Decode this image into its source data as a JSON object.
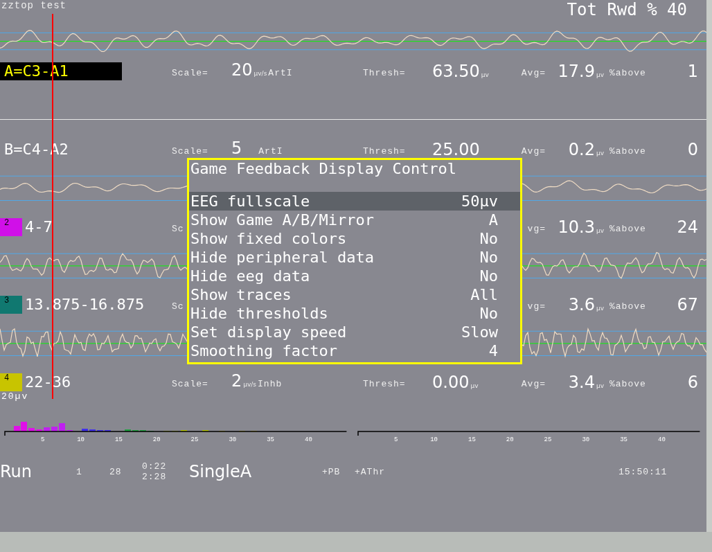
{
  "title": "zztop test",
  "reward": {
    "label": "Tot Rwd %",
    "value": "40"
  },
  "channels": [
    {
      "kind": "raw",
      "name": "A=C3-A1",
      "selected": true,
      "scale_label": "Scale=",
      "scale": "20",
      "scale_unit": "µv/s",
      "mode": "ArtI",
      "thresh_label": "Thresh=",
      "thresh": "63.50",
      "thresh_unit": "µv",
      "avg_label": "Avg=",
      "avg": "17.9",
      "avg_unit": "µv",
      "above_label": "%above",
      "above": "1"
    },
    {
      "kind": "raw",
      "name": "B=C4-A2",
      "selected": false,
      "scale_label": "Scale=",
      "scale": "5",
      "mode": "ArtI",
      "thresh_label": "Thresh=",
      "thresh": "25.00",
      "avg_label": "Avg=",
      "avg": "0.2",
      "avg_unit": "µv",
      "above_label": "%above",
      "above": "0"
    },
    {
      "kind": "band",
      "index": "2",
      "color": "#d010e8",
      "name": "4-7",
      "selected": false,
      "scale_label": "Sc",
      "avg_label": "vg=",
      "avg": "10.3",
      "avg_unit": "µv",
      "above_label": "%above",
      "above": "24"
    },
    {
      "kind": "band",
      "index": "3",
      "color": "#107870",
      "name": "13.875-16.875",
      "selected": false,
      "scale_label": "Sc",
      "avg_label": "vg=",
      "avg": "3.6",
      "avg_unit": "µv",
      "above_label": "%above",
      "above": "67"
    },
    {
      "kind": "band",
      "index": "4",
      "color": "#c8c400",
      "name": "22-36",
      "selected": false,
      "scale_label": "Scale=",
      "scale": "2",
      "scale_unit": "µv/s",
      "mode": "Inhb",
      "thresh_label": "Thresh=",
      "thresh": "0.00",
      "thresh_unit": "µv",
      "avg_label": "Avg=",
      "avg": "3.4",
      "avg_unit": "µv",
      "above_label": "%above",
      "above": "6"
    }
  ],
  "scale_note": "20µv",
  "spectra": [
    {
      "ticks": [
        "5",
        "10",
        "15",
        "20",
        "25",
        "30",
        "35",
        "40"
      ]
    },
    {
      "ticks": [
        "5",
        "10",
        "15",
        "20",
        "25",
        "30",
        "35",
        "40"
      ]
    }
  ],
  "status": {
    "mode": "Run",
    "count_1": "1",
    "count_2": "28",
    "time_elapsed": "0:22",
    "time_total": "2:28",
    "protocol": "SingleA",
    "flags": [
      "+PB",
      "+AThr"
    ],
    "clock": "15:50:11"
  },
  "dialog": {
    "title": "Game Feedback Display Control",
    "items": [
      {
        "label": "EEG fullscale",
        "value": "50µv",
        "selected": true
      },
      {
        "label": "Show Game A/B/Mirror",
        "value": "A",
        "selected": false
      },
      {
        "label": "Show fixed colors",
        "value": "No",
        "selected": false
      },
      {
        "label": "Hide peripheral data",
        "value": "No",
        "selected": false
      },
      {
        "label": "Hide eeg data",
        "value": "No",
        "selected": false
      },
      {
        "label": "Show traces",
        "value": "All",
        "selected": false
      },
      {
        "label": "Hide thresholds",
        "value": "No",
        "selected": false
      },
      {
        "label": "Set display speed",
        "value": "Slow",
        "selected": false
      },
      {
        "label": "Smoothing factor",
        "value": "4",
        "selected": false
      }
    ]
  }
}
